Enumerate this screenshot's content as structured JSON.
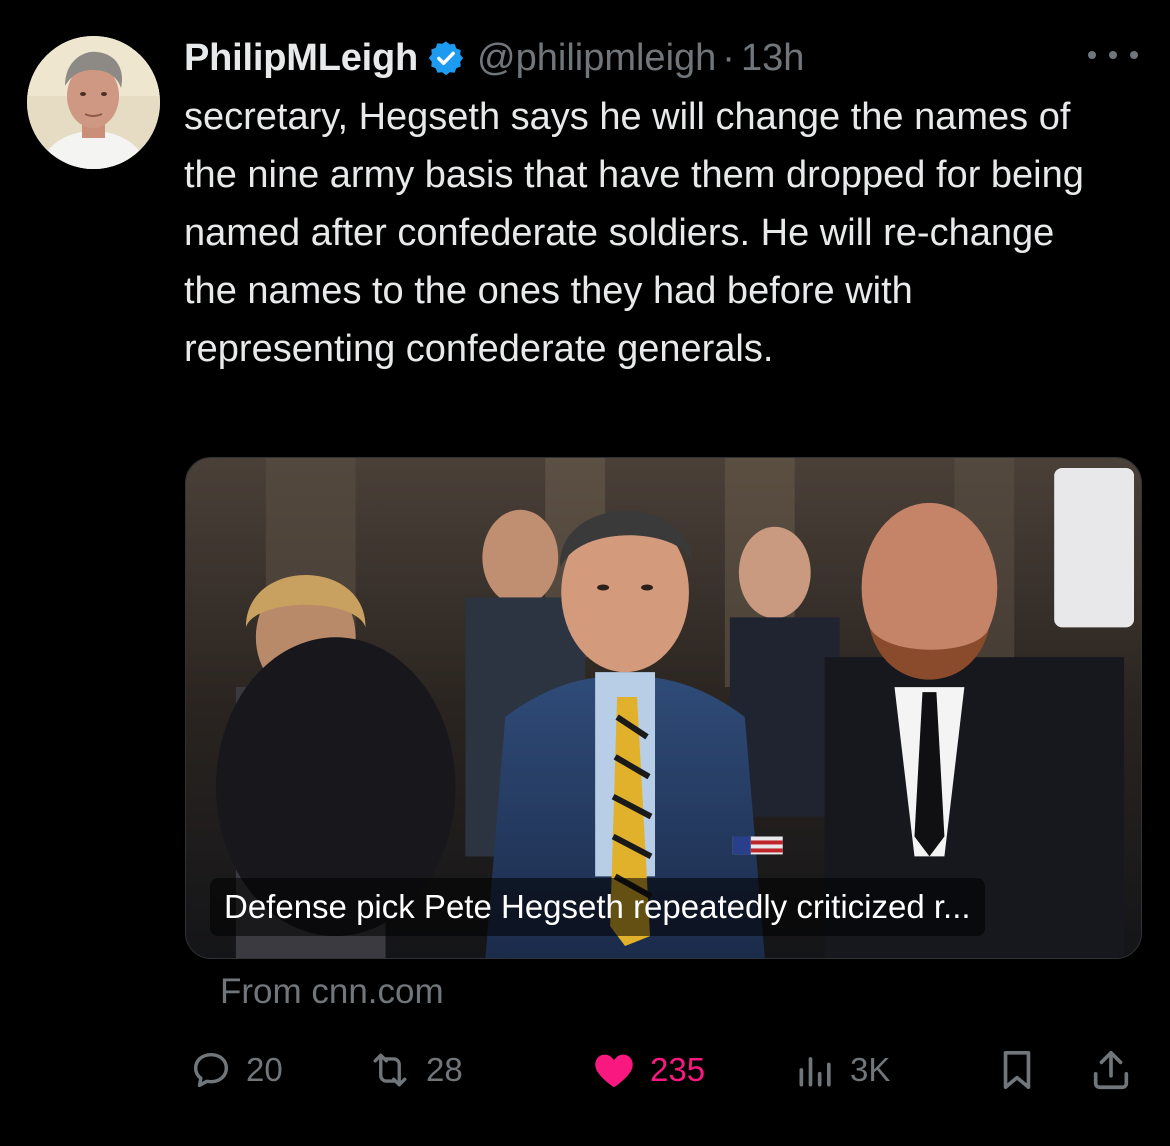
{
  "tweet": {
    "display_name": "PhilipMLeigh",
    "verified_icon": "verified-badge-icon",
    "handle": "@philipmleigh",
    "separator": "·",
    "time": "13h",
    "text": "secretary, Hegseth says he will change the names of the nine army basis that have them dropped for being named after confederate soldiers. He will re-change the names to the ones they had before with representing confederate generals."
  },
  "card": {
    "title": "Defense pick Pete Hegseth repeatedly criticized r...",
    "source": "From cnn.com"
  },
  "actions": {
    "replies": "20",
    "retweets": "28",
    "likes": "235",
    "views": "3K"
  },
  "colors": {
    "background": "#000000",
    "text": "#e7e9ea",
    "muted": "#71767b",
    "verified": "#1d9bf0",
    "like": "#f91880"
  }
}
